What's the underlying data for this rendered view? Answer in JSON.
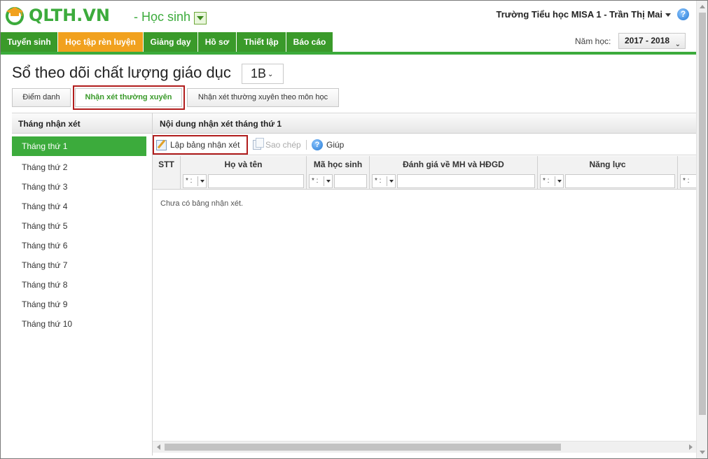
{
  "header": {
    "brand": "QLTH.VN",
    "role": "- Học sinh",
    "user": "Trường Tiểu học MISA 1 - Trần Thị Mai",
    "help": "?"
  },
  "nav": {
    "items": [
      {
        "label": "Tuyển sinh"
      },
      {
        "label": "Học tập rèn luyện"
      },
      {
        "label": "Giảng dạy"
      },
      {
        "label": "Hồ sơ"
      },
      {
        "label": "Thiết lập"
      },
      {
        "label": "Báo cáo"
      }
    ],
    "active_index": 1,
    "year_label": "Năm học:",
    "year_value": "2017 - 2018"
  },
  "page": {
    "title": "Sổ theo dõi chất lượng giáo dục",
    "class_value": "1B"
  },
  "tabs": [
    {
      "label": "Điểm danh"
    },
    {
      "label": "Nhận xét thường xuyên"
    },
    {
      "label": "Nhận xét thường xuyên theo môn học"
    }
  ],
  "left_panel": {
    "title": "Tháng nhận xét",
    "months": [
      "Tháng thứ 1",
      "Tháng thứ 2",
      "Tháng thứ 3",
      "Tháng thứ 4",
      "Tháng thứ 5",
      "Tháng thứ 6",
      "Tháng thứ 7",
      "Tháng thứ 8",
      "Tháng thứ 9",
      "Tháng thứ 10"
    ],
    "active_index": 0
  },
  "right_panel": {
    "title": "Nội dung nhận xét tháng thứ 1",
    "toolbar": {
      "create": "Lập bảng nhận xét",
      "copy": "Sao chép",
      "help": "Giúp"
    },
    "columns": [
      "STT",
      "Họ và tên",
      "Mã học sinh",
      "Đánh giá về MH và HĐGD",
      "Năng lực"
    ],
    "filter_op": "* :",
    "empty_text": "Chưa có bảng nhận xét."
  },
  "colors": {
    "brand_green": "#3cab3c",
    "nav_active": "#f1a11e",
    "highlight": "#b11d1d"
  }
}
